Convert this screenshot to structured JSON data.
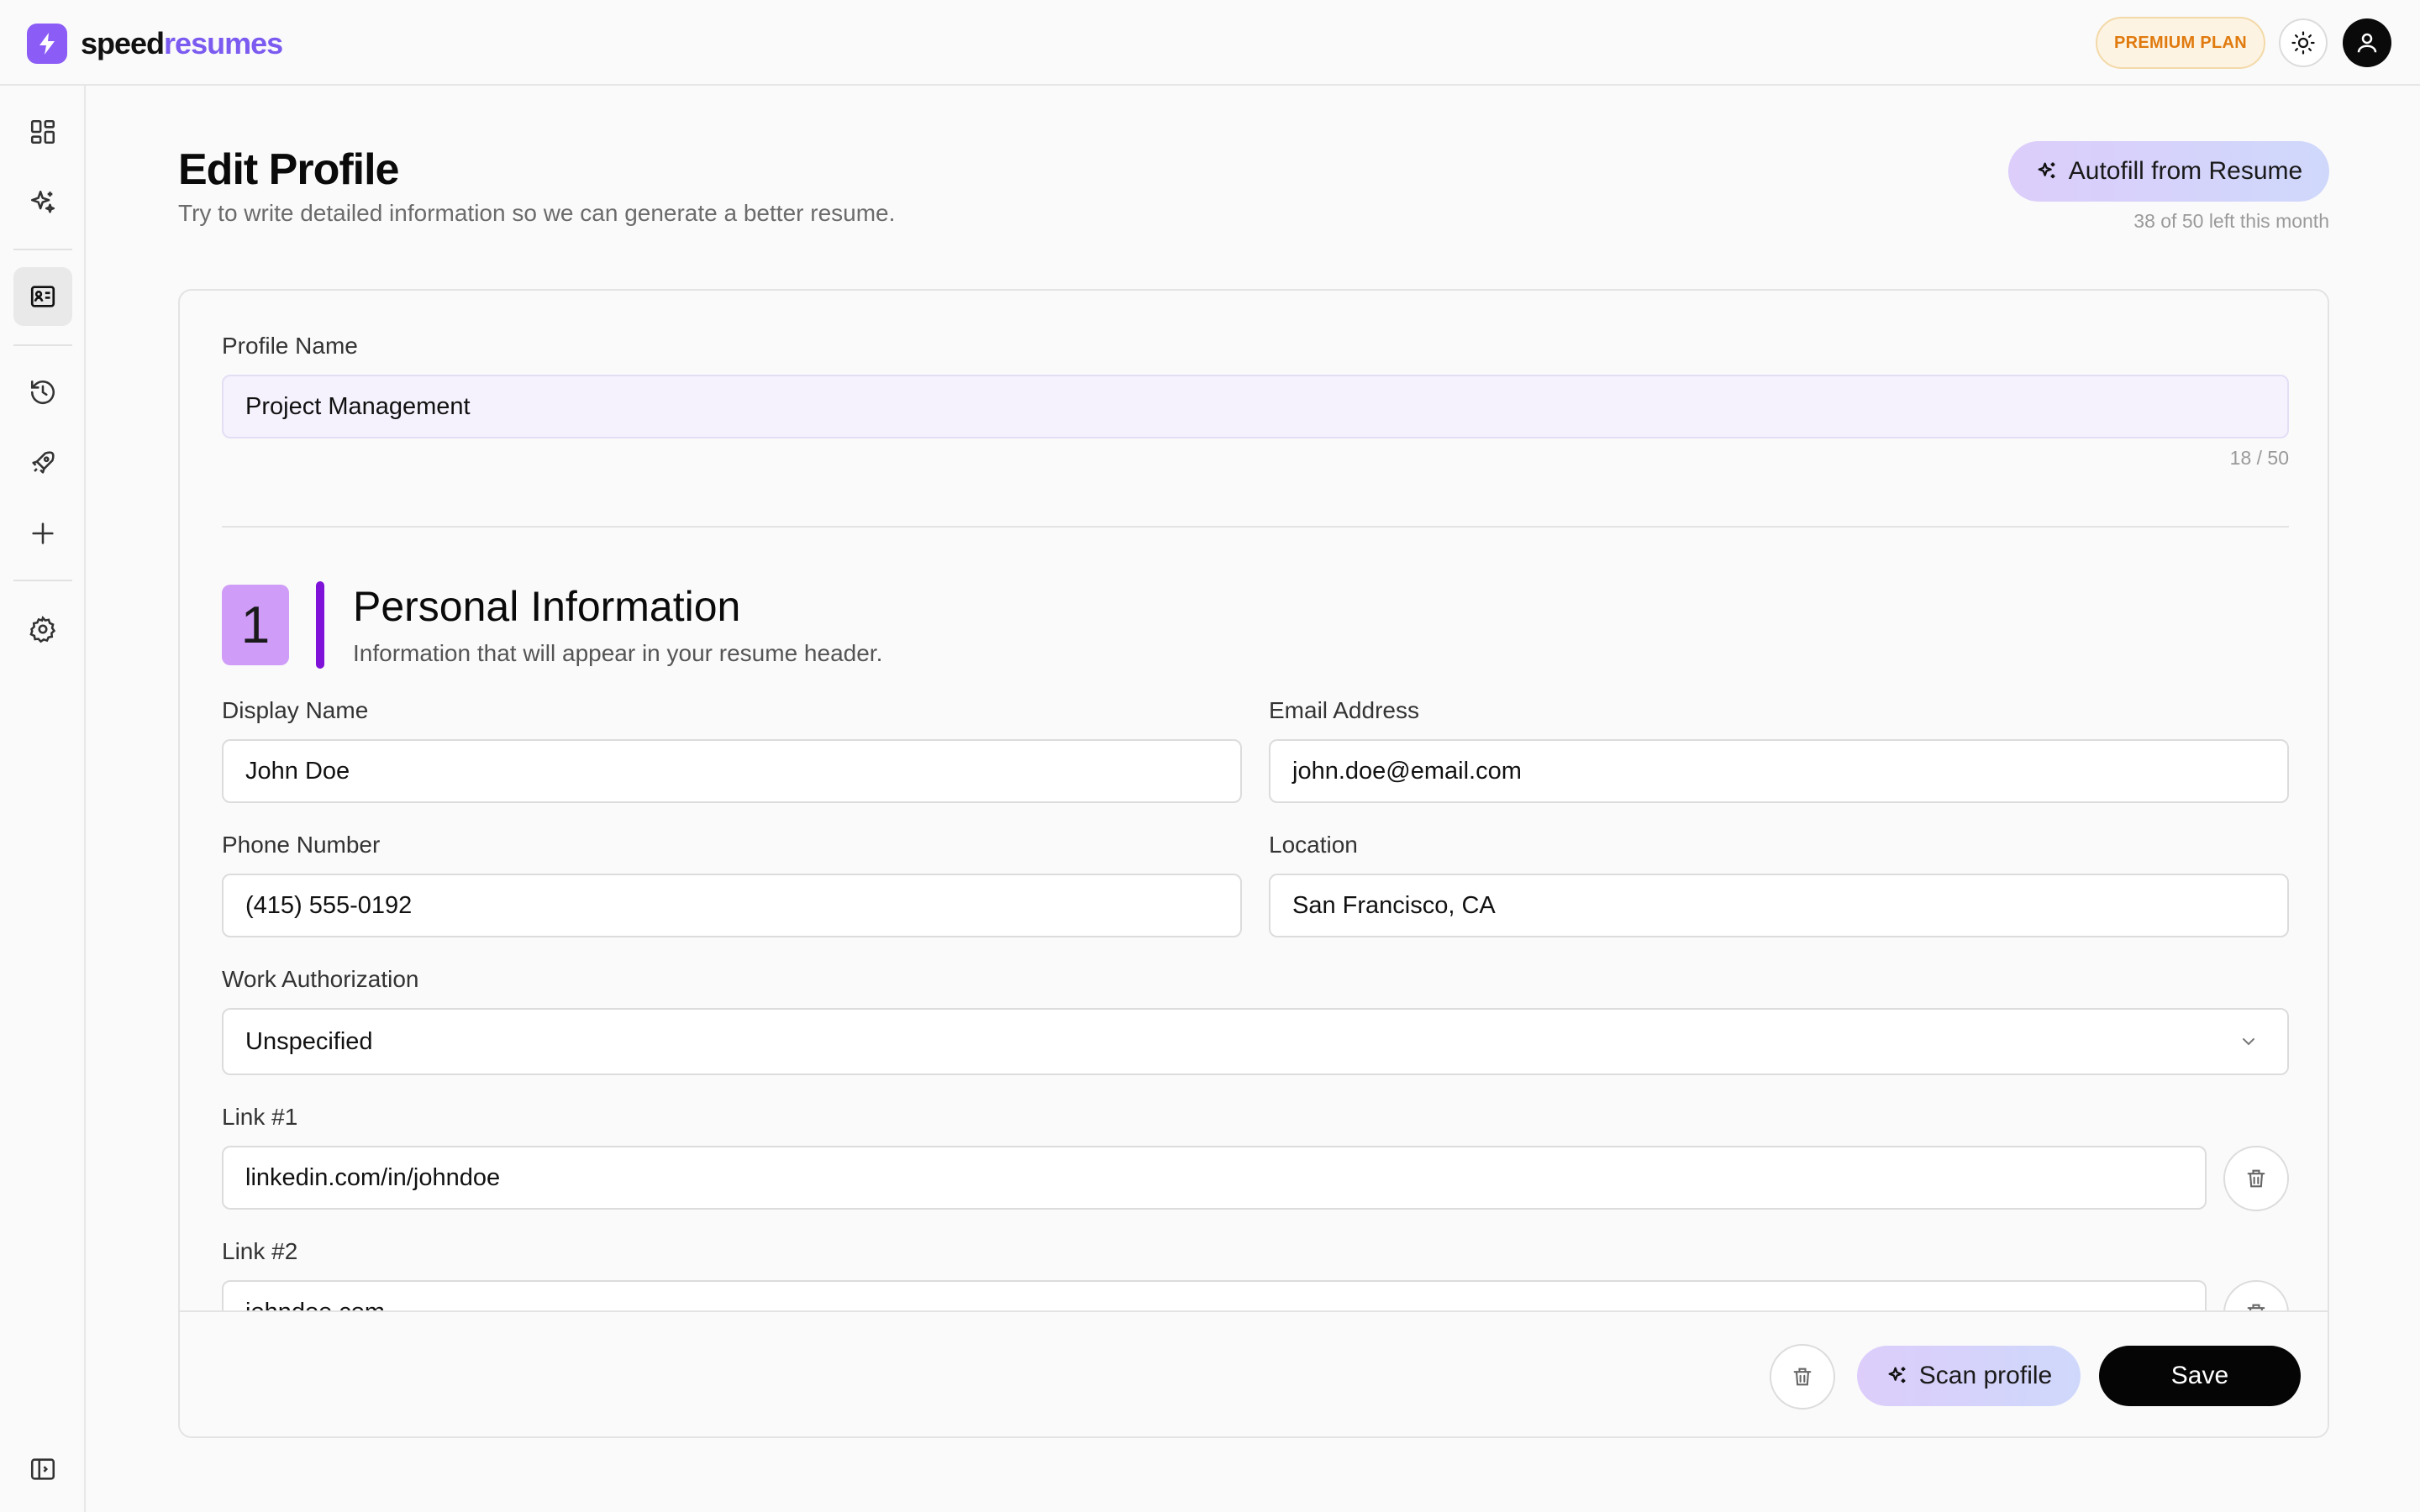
{
  "app": {
    "brand_part1": "speed",
    "brand_part2": "resumes",
    "brand_color": "#7c5cf0",
    "plan_badge": "PREMIUM PLAN",
    "plan_color": "#e07a0e"
  },
  "sidebar": {
    "items": [
      {
        "icon": "dashboard-icon"
      },
      {
        "icon": "sparkles-icon"
      },
      {
        "icon": "id-card-icon",
        "active": true
      },
      {
        "icon": "history-icon"
      },
      {
        "icon": "rocket-icon"
      },
      {
        "icon": "plus-icon"
      },
      {
        "icon": "settings-icon"
      },
      {
        "icon": "sidebar-toggle-icon"
      }
    ]
  },
  "page": {
    "title": "Edit Profile",
    "subtitle": "Try to write detailed information so we can generate a better resume.",
    "autofill_label": "Autofill from Resume",
    "autofill_quota": "38 of 50 left this month"
  },
  "form": {
    "profile_name_label": "Profile Name",
    "profile_name_value": "Project Management",
    "profile_name_counter": "18 / 50",
    "section": {
      "number": "1",
      "title": "Personal Information",
      "subtitle": "Information that will appear in your resume header.",
      "accent": "#7e12d8"
    },
    "display_name_label": "Display Name",
    "display_name_value": "John Doe",
    "email_label": "Email Address",
    "email_value": "john.doe@email.com",
    "phone_label": "Phone Number",
    "phone_value": "(415) 555-0192",
    "location_label": "Location",
    "location_value": "San Francisco, CA",
    "work_auth_label": "Work Authorization",
    "work_auth_value": "Unspecified",
    "link1_label": "Link #1",
    "link1_value": "linkedin.com/in/johndoe",
    "link2_label": "Link #2",
    "link2_value": "johndoe.com"
  },
  "footer": {
    "scan_label": "Scan profile",
    "save_label": "Save"
  }
}
